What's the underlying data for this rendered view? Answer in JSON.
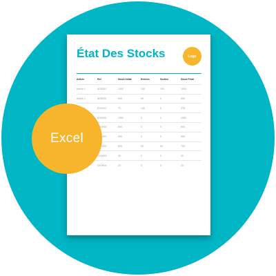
{
  "colors": {
    "background": "#ffffff",
    "teal": "#00b5c4",
    "yellow": "#f7b52c",
    "paper": "#ffffff"
  },
  "document": {
    "title": "État Des Stocks",
    "logo_label": "Logo",
    "columns": [
      "Article",
      "Ref",
      "Stock initial",
      "Entrées",
      "Sorties",
      "Stock Final"
    ],
    "rows": [
      [
        "Article 1",
        "ADD001",
        "1000",
        "140",
        "100",
        "1000"
      ],
      [
        "Article 2",
        "ADD002",
        "600",
        "50",
        "0",
        "600"
      ],
      [
        "Article 3",
        "BXO001",
        "70",
        "140",
        "0",
        "275"
      ],
      [
        "",
        "BXO002",
        "1000",
        "0",
        "0",
        "1000"
      ],
      [
        "",
        "BXO003",
        "500",
        "0",
        "0",
        "500"
      ],
      [
        "",
        "CKO001",
        "300",
        "0",
        "0",
        "300"
      ],
      [
        "",
        "CKO002",
        "800",
        "50",
        "60",
        "790"
      ],
      [
        "",
        "CKO003",
        "30",
        "0",
        "0",
        "30"
      ],
      [
        "",
        "CKO004",
        "20",
        "0",
        "0",
        "20"
      ]
    ]
  },
  "badge": {
    "label": "Excel"
  }
}
